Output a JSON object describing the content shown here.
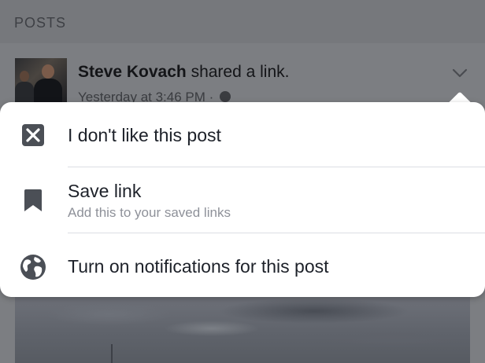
{
  "section": {
    "title": "POSTS"
  },
  "post": {
    "author": "Steve Kovach",
    "action": " shared a link.",
    "timestamp": "Yesterday at 3:46 PM",
    "separator": " · ",
    "privacy_icon": "globe-icon",
    "menu_icon": "chevron-down-icon"
  },
  "menu": {
    "items": [
      {
        "label": "I don't like this post",
        "icon": "hide-x-icon"
      },
      {
        "label": "Save link",
        "sublabel": "Add this to your saved links",
        "icon": "bookmark-icon"
      },
      {
        "label": "Turn on notifications for this post",
        "icon": "globe-icon"
      }
    ]
  },
  "colors": {
    "overlay_dim": "#7b7d82",
    "menu_bg": "#ffffff",
    "icon": "#4b4f56",
    "text": "#1d2129",
    "subtext": "#8e9199",
    "divider": "#dcdee3"
  }
}
